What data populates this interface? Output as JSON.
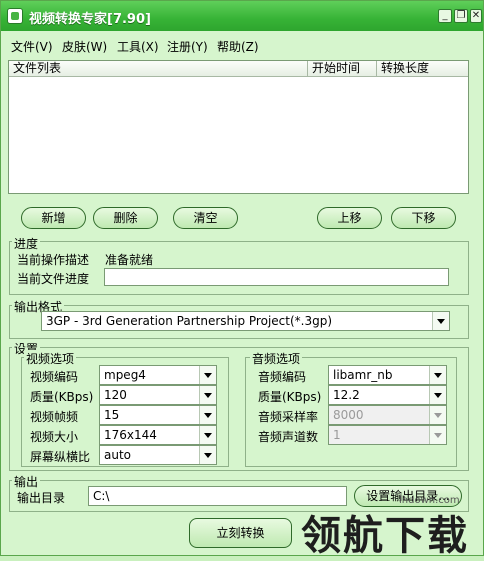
{
  "window": {
    "title": "视频转换专家[7.90]"
  },
  "titlebar_buttons": {
    "minimize": "_",
    "restore": "❐",
    "close": "✕"
  },
  "menu": [
    "文件(V)",
    "皮肤(W)",
    "工具(X)",
    "注册(Y)",
    "帮助(Z)"
  ],
  "file_list": {
    "columns": [
      "文件列表",
      "开始时间",
      "转换长度"
    ]
  },
  "buttons": {
    "add": "新增",
    "delete": "删除",
    "clear": "清空",
    "up": "上移",
    "down": "下移",
    "set_output_dir": "设置输出目录...",
    "convert": "立刻转换"
  },
  "progress": {
    "group": "进度",
    "op_label": "当前操作描述",
    "op_value": "准备就绪",
    "file_label": "当前文件进度"
  },
  "output_format": {
    "group": "输出格式",
    "value": "3GP - 3rd Generation Partnership Project(*.3gp)"
  },
  "settings": {
    "group": "设置",
    "video": {
      "group": "视频选项",
      "codec_label": "视频编码",
      "codec": "mpeg4",
      "quality_label": "质量(KBps)",
      "quality": "120",
      "fps_label": "视频帧频",
      "fps": "15",
      "size_label": "视频大小",
      "size": "176x144",
      "aspect_label": "屏幕纵横比",
      "aspect": "auto"
    },
    "audio": {
      "group": "音频选项",
      "codec_label": "音频编码",
      "codec": "libamr_nb",
      "quality_label": "质量(KBps)",
      "quality": "12.2",
      "rate_label": "音频采样率",
      "rate": "8000",
      "channels_label": "音频声道数",
      "channels": "1"
    }
  },
  "output": {
    "group": "输出",
    "dir_label": "输出目录",
    "dir_value": "C:\\"
  },
  "watermark": {
    "text": "领航下载",
    "url": "lhdown.com"
  }
}
